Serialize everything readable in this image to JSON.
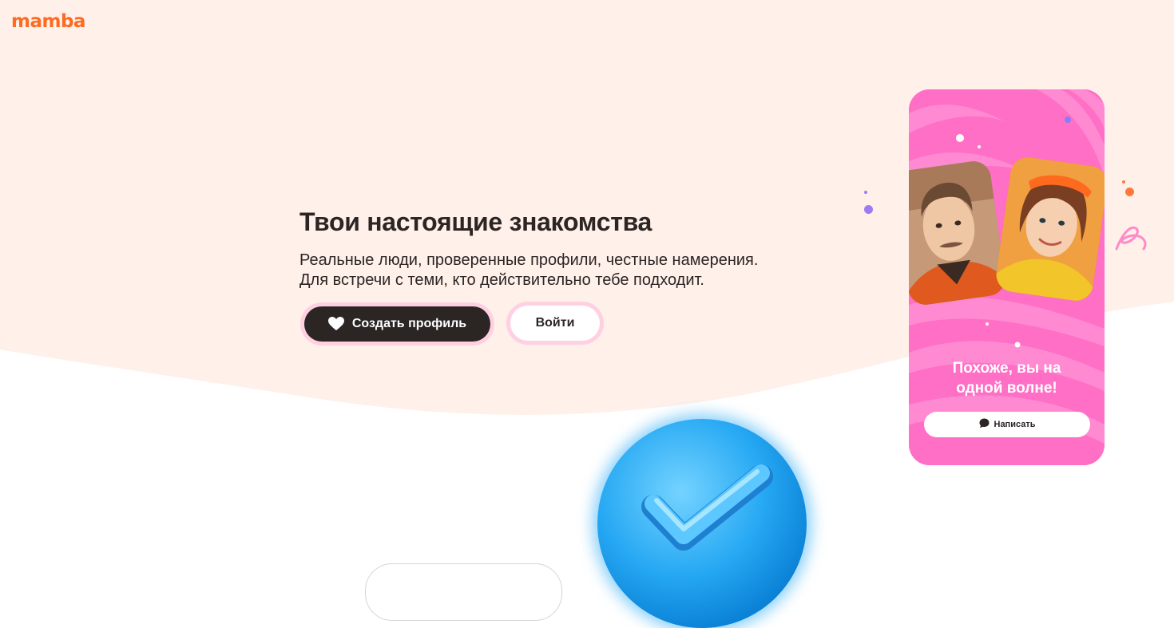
{
  "header": {
    "logo_text": "mamba"
  },
  "hero": {
    "title": "Твои настоящие знакомства",
    "subtitle": "Реальные люди, проверенные профили, честные намерения. Для встречи с теми, кто действительно тебе подходит.",
    "create_profile_label": "Создать профиль",
    "login_label": "Войти"
  },
  "phone_mockup": {
    "match_text_line1": "Похоже, вы на",
    "match_text_line2": "одной волне!",
    "write_button_label": "Написать"
  },
  "colors": {
    "brand_orange": "#ff6a1f",
    "hero_background": "#fff0ea",
    "dark_button": "#2b2524",
    "button_ring": "#ffd0e2",
    "phone_pink": "#ff6fc6",
    "verified_blue": "#26a8f3"
  },
  "icons": [
    "heart-icon",
    "chat-bubble-icon",
    "checkmark-icon"
  ]
}
